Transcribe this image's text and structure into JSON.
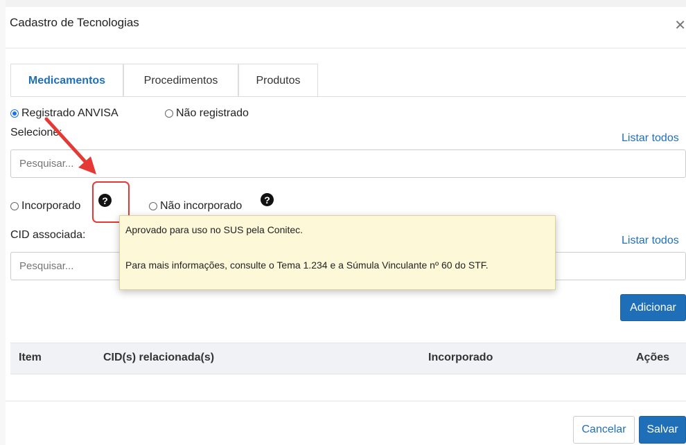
{
  "modal": {
    "title": "Cadastro de Tecnologias",
    "close_icon": "close-icon"
  },
  "tabs": [
    {
      "label": "Medicamentos",
      "active": true
    },
    {
      "label": "Procedimentos",
      "active": false
    },
    {
      "label": "Produtos",
      "active": false
    }
  ],
  "registro": {
    "options": [
      {
        "label": "Registrado ANVISA",
        "checked": true
      },
      {
        "label": "Não registrado",
        "checked": false
      }
    ]
  },
  "selecione": {
    "label": "Selecione:",
    "listar_todos": "Listar todos",
    "placeholder": "Pesquisar..."
  },
  "incorporacao": {
    "options": [
      {
        "label": "Incorporado",
        "checked": false
      },
      {
        "label": "Não incorporado",
        "checked": false
      }
    ],
    "help_icon": "question-circle-icon"
  },
  "cid": {
    "label": "CID associada:",
    "listar_todos": "Listar todos",
    "placeholder": "Pesquisar..."
  },
  "tooltip": {
    "line1": "Aprovado para uso no SUS pela Conitec.",
    "line2": "Para mais informações, consulte o Tema 1.234 e a Súmula Vinculante nº 60 do STF."
  },
  "buttons": {
    "adicionar": "Adicionar",
    "cancelar": "Cancelar",
    "salvar": "Salvar"
  },
  "table": {
    "columns": [
      "Item",
      "CID(s) relacionada(s)",
      "Incorporado",
      "Ações"
    ]
  },
  "colors": {
    "accent": "#1f6fb8",
    "highlight": "#e53935",
    "tooltip_bg": "#fcf8d8"
  }
}
